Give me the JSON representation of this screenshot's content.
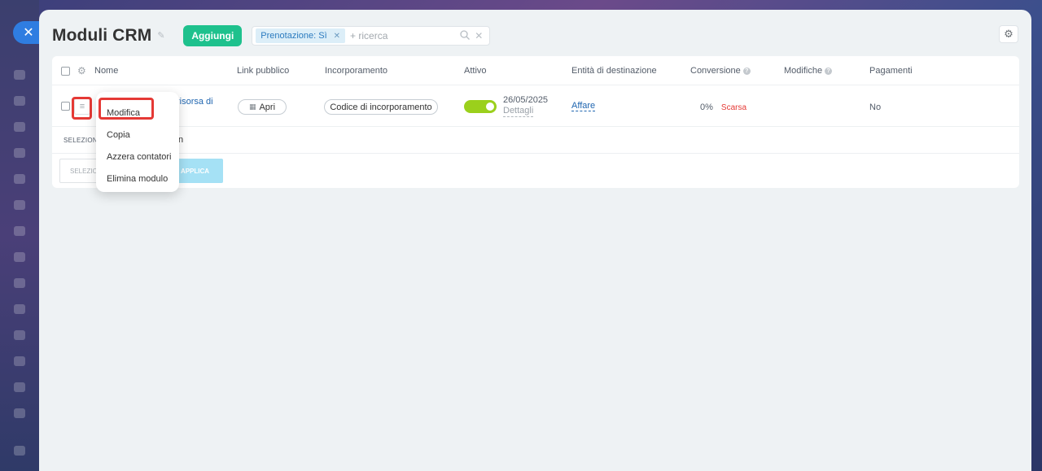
{
  "close_icon": "close-icon",
  "header": {
    "title": "Moduli CRM",
    "add_label": "Aggiungi",
    "filter_chip": "Prenotazione: Sì",
    "search_placeholder": "+ ricerca"
  },
  "table": {
    "columns": [
      "Nome",
      "Link pubblico",
      "Incorporamento",
      "Attivo",
      "Entità di destinazione",
      "Conversione",
      "Modifiche",
      "Pagamenti"
    ],
    "row": {
      "name_fragment": "risorsa di",
      "public_link_label": "Apri",
      "embed_label": "Codice di incorporamento",
      "active": true,
      "date": "26/05/2025",
      "details_label": "Dettagli",
      "entity": "Affare",
      "conversion_value": "0%",
      "conversion_rating": "Scarsa",
      "payments": "No"
    },
    "action_bar_label": "SELEZIONA",
    "action_bar_suffix": "n",
    "bottom_select_label": "SELEZIO",
    "apply_label": "APPLICA"
  },
  "context_menu": {
    "items": [
      "Modifica",
      "Copia",
      "Azzera contatori",
      "Elimina modulo"
    ]
  },
  "colors": {
    "accent_green": "#1ec18d",
    "toggle_active": "#9bd01c",
    "highlight_red": "#e53935",
    "link_blue": "#2066b0"
  }
}
